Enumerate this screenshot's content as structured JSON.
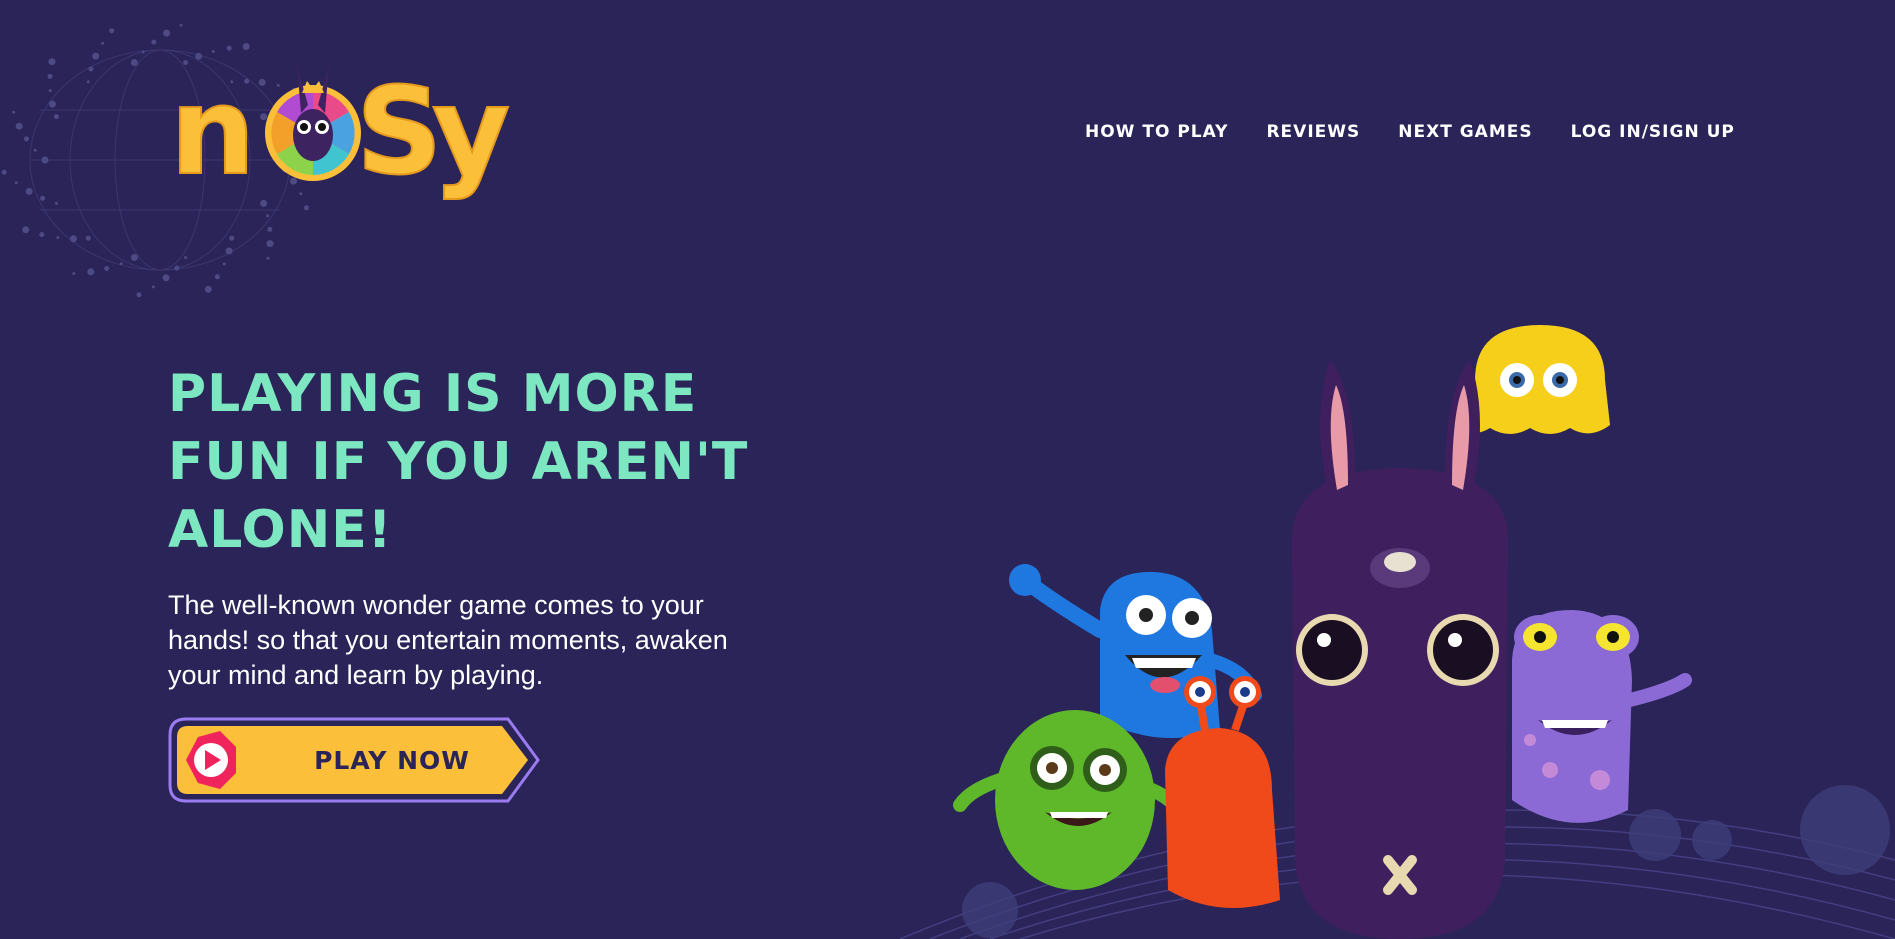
{
  "logo": {
    "text": "nosy",
    "icon": "bunny-mascot-logo"
  },
  "nav": {
    "items": [
      {
        "label": "HOW TO PLAY"
      },
      {
        "label": "REVIEWS"
      },
      {
        "label": "NEXT GAMES"
      },
      {
        "label": "LOG IN/SIGN UP"
      }
    ]
  },
  "hero": {
    "headline_lines": [
      "PLAYING IS MORE",
      "FUN IF YOU AREN'T",
      "ALONE!"
    ],
    "description_lines": [
      "The well-known wonder game comes to your",
      "hands! so that you entertain moments, awaken",
      "your mind and learn by playing."
    ],
    "cta_label": "PLAY NOW",
    "cta_icon": "play-icon"
  },
  "colors": {
    "background": "#2a2458",
    "headline": "#7ce7c0",
    "accent_yellow": "#fbbf3a",
    "button_border": "#9b7cf0",
    "play_icon": "#f0245c"
  },
  "characters": [
    "yellow-octopus",
    "blue-monster",
    "green-monster",
    "orange-snail",
    "purple-bunny",
    "lilac-alien"
  ]
}
